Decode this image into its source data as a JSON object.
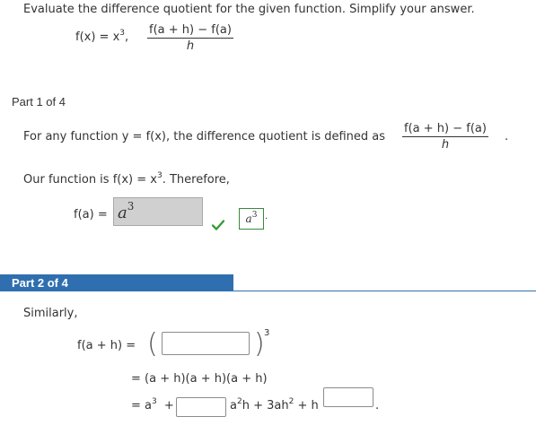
{
  "question": {
    "instruction": "Evaluate the difference quotient for the given function. Simplify your answer.",
    "function_lhs": "f(x) = x",
    "function_exp": "3",
    "function_sep": ",",
    "quotient_num": "f(a + h) − f(a)",
    "quotient_den": "h"
  },
  "part1": {
    "label": "Part 1 of 4",
    "definition_text": "For any function  y = f(x),  the difference quotient is defined as",
    "definition_num": "f(a + h) − f(a)",
    "definition_den": "h",
    "definition_end": ".",
    "our_function_text": "Our function is  f(x) = x",
    "our_function_exp": "3",
    "our_function_end": ". Therefore,",
    "fa_label": "f(a)  =",
    "answer_base": "a",
    "answer_exp": "3",
    "correct_base": "a",
    "correct_exp": "3",
    "correct_end": "."
  },
  "part2": {
    "label": "Part 2 of 4",
    "similarly": "Similarly,",
    "fah_label": "f(a + h)  =",
    "outer_exp": "3",
    "line2": "=  (a + h)(a + h)(a + h)",
    "line3_start": "=  a",
    "line3_exp": "3",
    "line3_plus": "+",
    "line3_mid": "a",
    "line3_mid_exp": "2",
    "line3_mid_rest": "h  +  3ah",
    "line3_mid_exp2": "2",
    "line3_rest": "  +  h",
    "line3_end": "."
  },
  "colors": {
    "part_header_bg": "#2f6fb0",
    "check_green": "#3a9a3a",
    "answer_box_bg": "#d0d0d0"
  }
}
